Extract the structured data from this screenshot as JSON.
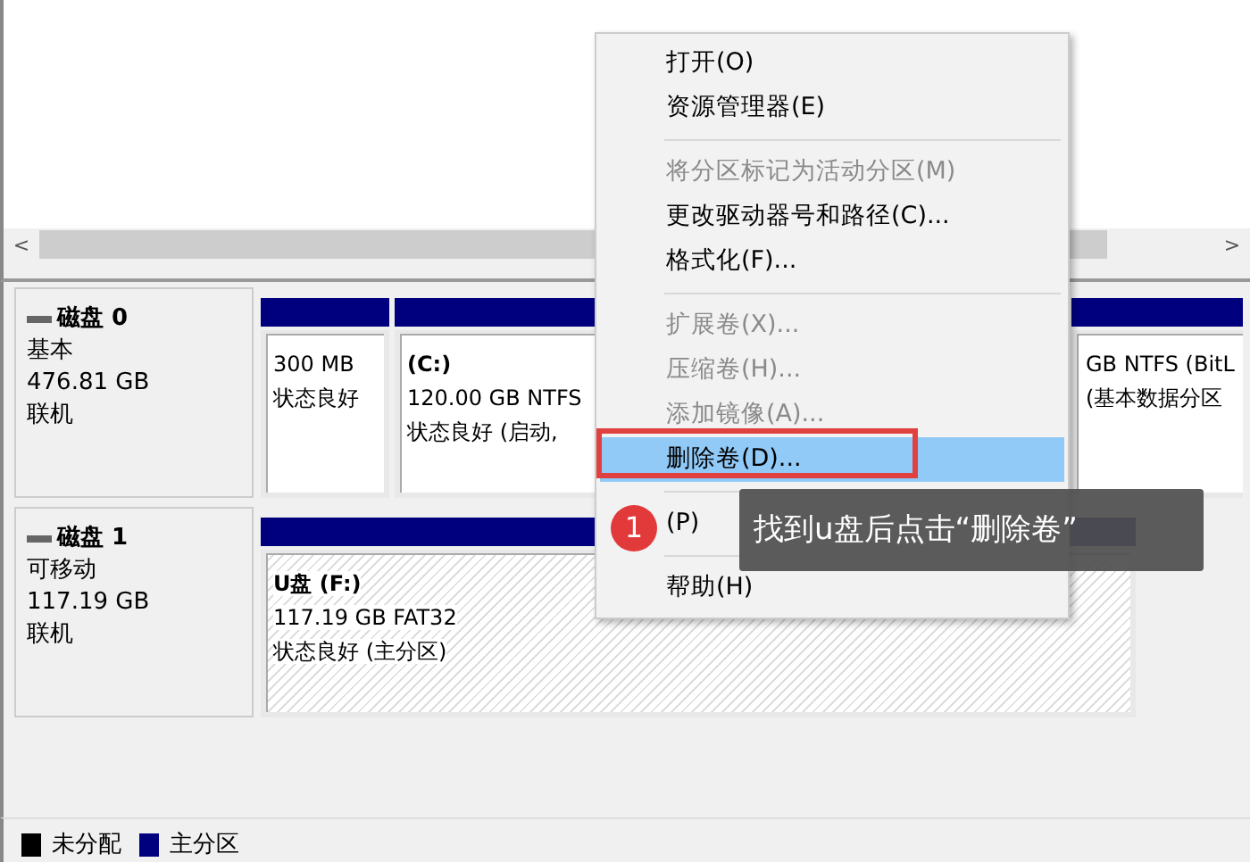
{
  "scrollbar": {
    "left_arrow": "<",
    "right_arrow": ">"
  },
  "disks": [
    {
      "name": "磁盘 0",
      "type": "基本",
      "size": "476.81 GB",
      "status": "联机",
      "partitions": [
        {
          "kind": "plain",
          "lines": [
            "300 MB",
            "状态良好"
          ]
        },
        {
          "kind": "plain",
          "title": "(C:)",
          "lines": [
            "120.00 GB NTFS",
            "状态良好 (启动,"
          ]
        },
        {
          "kind": "plain",
          "lines": [
            "GB NTFS (BitL",
            "(基本数据分区"
          ]
        }
      ]
    },
    {
      "name": "磁盘 1",
      "type": "可移动",
      "size": "117.19 GB",
      "status": "联机",
      "partitions": [
        {
          "kind": "hatched",
          "title": "U盘 (F:)",
          "lines": [
            "117.19 GB FAT32",
            "状态良好 (主分区)"
          ]
        }
      ]
    }
  ],
  "legend": [
    {
      "label": "未分配",
      "color": "#000000"
    },
    {
      "label": "主分区",
      "color": "#00007f"
    }
  ],
  "context_menu": [
    {
      "kind": "item",
      "label": "打开(O)",
      "disabled": false,
      "selected": false
    },
    {
      "kind": "item",
      "label": "资源管理器(E)",
      "disabled": false,
      "selected": false
    },
    {
      "kind": "separator"
    },
    {
      "kind": "item",
      "label": "将分区标记为活动分区(M)",
      "disabled": true,
      "selected": false
    },
    {
      "kind": "item",
      "label": "更改驱动器号和路径(C)...",
      "disabled": false,
      "selected": false
    },
    {
      "kind": "item",
      "label": "格式化(F)...",
      "disabled": false,
      "selected": false
    },
    {
      "kind": "separator"
    },
    {
      "kind": "item",
      "label": "扩展卷(X)...",
      "disabled": true,
      "selected": false
    },
    {
      "kind": "item",
      "label": "压缩卷(H)...",
      "disabled": true,
      "selected": false
    },
    {
      "kind": "item",
      "label": "添加镜像(A)...",
      "disabled": true,
      "selected": false
    },
    {
      "kind": "item",
      "label": "删除卷(D)...",
      "disabled": false,
      "selected": true
    },
    {
      "kind": "separator"
    },
    {
      "kind": "item",
      "label": "(P)",
      "disabled": false,
      "selected": false
    },
    {
      "kind": "separator"
    },
    {
      "kind": "item",
      "label": "帮助(H)",
      "disabled": false,
      "selected": false
    }
  ],
  "annotation": {
    "step": "1",
    "text": "找到u盘后点击“删除卷”"
  }
}
